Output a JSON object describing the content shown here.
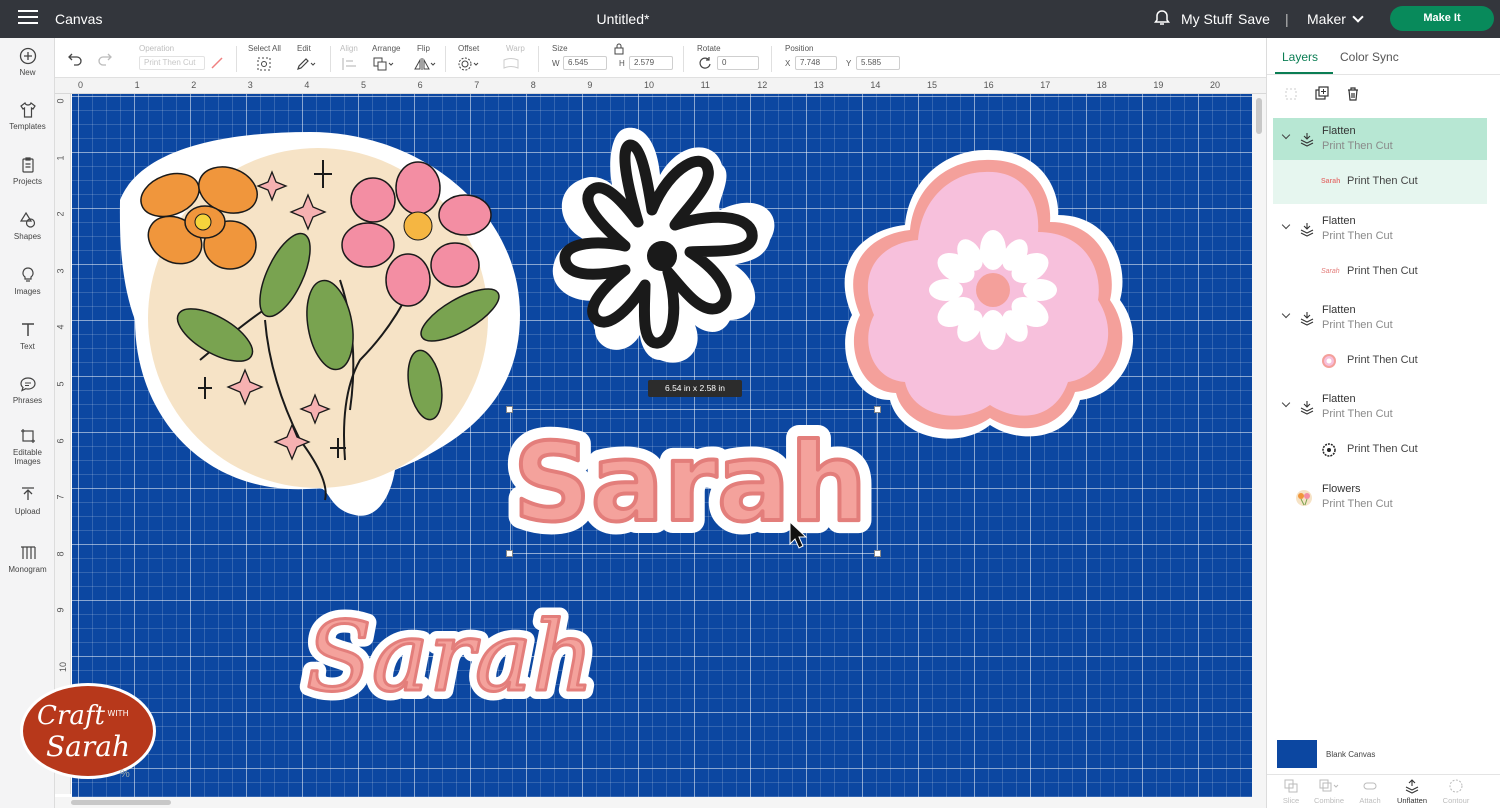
{
  "topbar": {
    "brand": "Canvas",
    "doc_title": "Untitled*",
    "my_stuff": "My Stuff",
    "save": "Save",
    "separator": "|",
    "machine": "Maker",
    "make_it": "Make It"
  },
  "sidebar": {
    "items": [
      {
        "label": "New",
        "icon": "plus-circle-icon"
      },
      {
        "label": "Templates",
        "icon": "tshirt-icon"
      },
      {
        "label": "Projects",
        "icon": "projects-icon"
      },
      {
        "label": "Shapes",
        "icon": "shapes-icon"
      },
      {
        "label": "Images",
        "icon": "lightbulb-icon"
      },
      {
        "label": "Text",
        "icon": "text-icon"
      },
      {
        "label": "Phrases",
        "icon": "speech-bubble-icon"
      },
      {
        "label": "Editable Images",
        "icon": "editable-image-icon"
      },
      {
        "label": "Upload",
        "icon": "upload-icon"
      },
      {
        "label": "Monogram",
        "icon": "monogram-icon"
      }
    ]
  },
  "toolbar": {
    "operation_label": "Operation",
    "operation_value": "Print Then Cut",
    "select_all": "Select All",
    "edit": "Edit",
    "align": "Align",
    "arrange": "Arrange",
    "flip": "Flip",
    "offset": "Offset",
    "warp": "Warp",
    "size": "Size",
    "w_label": "W",
    "w_value": "6.545",
    "h_label": "H",
    "h_value": "2.579",
    "rotate": "Rotate",
    "rotate_value": "0",
    "position": "Position",
    "x_label": "X",
    "x_value": "7.748",
    "y_label": "Y",
    "y_value": "5.585"
  },
  "rulers": {
    "top": [
      "0",
      "1",
      "2",
      "3",
      "4",
      "5",
      "6",
      "7",
      "8",
      "9",
      "10",
      "11",
      "12",
      "13",
      "14",
      "15",
      "16",
      "17",
      "18",
      "19",
      "20"
    ],
    "left": [
      "0",
      "1",
      "2",
      "3",
      "4",
      "5",
      "6",
      "7",
      "8",
      "9",
      "10"
    ]
  },
  "canvas": {
    "dimension_tooltip": "6.54  in x 2.58  in",
    "text_block": "Sarah",
    "text_script": "Sarah",
    "zoom_fragment": "%",
    "background": "#0c47a1"
  },
  "logo": {
    "line1": "Craft",
    "line2": "WITH",
    "line3": "Sarah"
  },
  "panel": {
    "tabs": [
      "Layers",
      "Color Sync"
    ],
    "groups": [
      {
        "name": "Flatten",
        "sub": "Print Then Cut",
        "child": "Print Then Cut",
        "thumb": "Sarah",
        "selected": true
      },
      {
        "name": "Flatten",
        "sub": "Print Then Cut",
        "child": "Print Then Cut",
        "thumb": "Sarah",
        "selected": false
      },
      {
        "name": "Flatten",
        "sub": "Print Then Cut",
        "child": "Print Then Cut",
        "thumb": "pink-flower",
        "selected": false
      },
      {
        "name": "Flatten",
        "sub": "Print Then Cut",
        "child": "Print Then Cut",
        "thumb": "daisy",
        "selected": false
      }
    ],
    "flowers": {
      "name": "Flowers",
      "sub": "Print Then Cut"
    },
    "blank_canvas": "Blank Canvas",
    "bottom_tools": [
      "Slice",
      "Combine",
      "Attach",
      "Unflatten",
      "Contour"
    ]
  },
  "colors": {
    "accent": "#0b7e54",
    "make_it": "#088a5b",
    "topbar": "#33363c",
    "sticker_pink": "#f4a29c",
    "sticker_outline": "#e37e7b"
  }
}
